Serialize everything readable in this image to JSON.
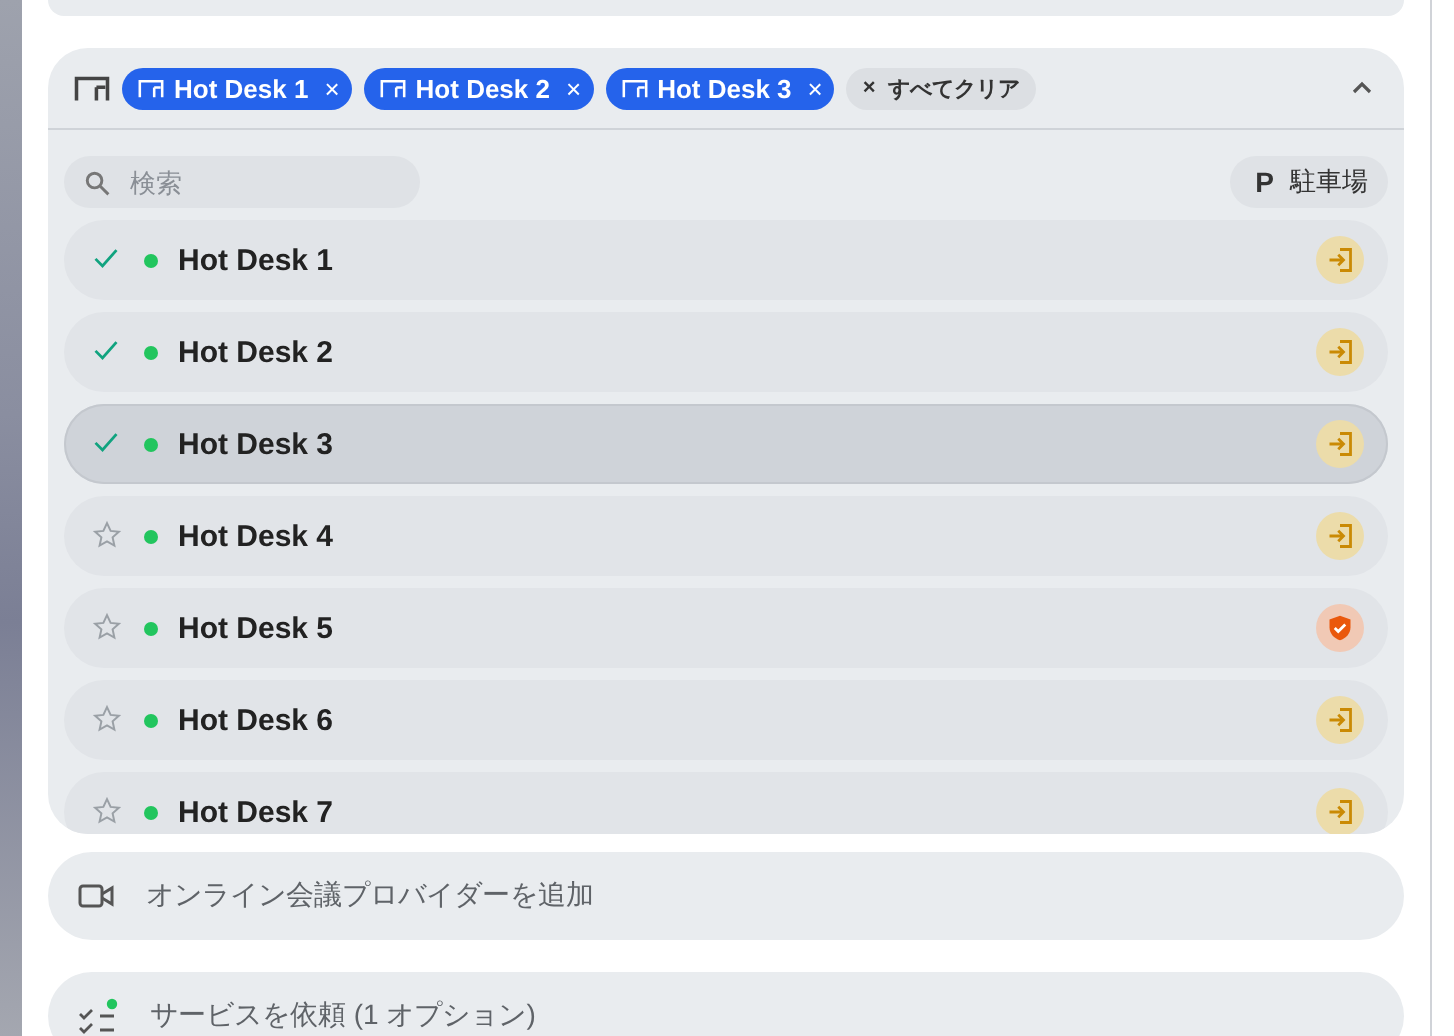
{
  "chips": [
    {
      "label": "Hot Desk 1",
      "close": "×"
    },
    {
      "label": "Hot Desk 2",
      "close": "×"
    },
    {
      "label": "Hot Desk 3",
      "close": "×"
    }
  ],
  "clear_all": {
    "icon": "×",
    "label": "すべてクリア"
  },
  "expanded": true,
  "search": {
    "placeholder": "検索"
  },
  "parking": {
    "icon": "P",
    "label": "駐車場"
  },
  "desks": [
    {
      "name": "Hot Desk 1",
      "selected": true,
      "highlighted": false,
      "available": true,
      "kind": "check-in"
    },
    {
      "name": "Hot Desk 2",
      "selected": true,
      "highlighted": false,
      "available": true,
      "kind": "check-in"
    },
    {
      "name": "Hot Desk 3",
      "selected": true,
      "highlighted": true,
      "available": true,
      "kind": "check-in"
    },
    {
      "name": "Hot Desk 4",
      "selected": false,
      "highlighted": false,
      "available": true,
      "kind": "check-in"
    },
    {
      "name": "Hot Desk 5",
      "selected": false,
      "highlighted": false,
      "available": true,
      "kind": "shield"
    },
    {
      "name": "Hot Desk 6",
      "selected": false,
      "highlighted": false,
      "available": true,
      "kind": "check-in"
    },
    {
      "name": "Hot Desk 7",
      "selected": false,
      "highlighted": false,
      "available": true,
      "kind": "check-in"
    }
  ],
  "options": [
    {
      "kind": "video",
      "label": "オンライン会議プロバイダーを追加"
    },
    {
      "kind": "services",
      "label": "サービスを依頼 (1 オプション)"
    }
  ]
}
